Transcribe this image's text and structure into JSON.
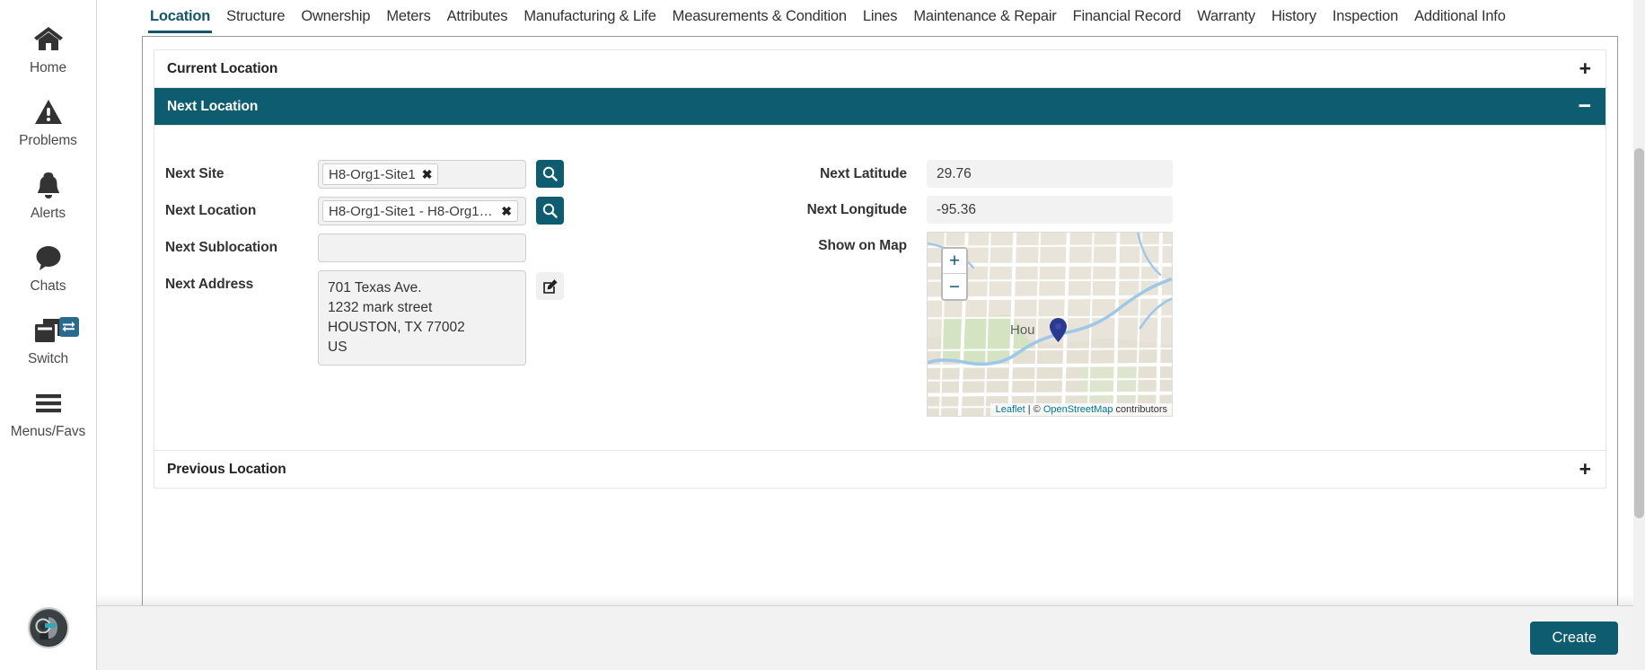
{
  "sidebar": {
    "items": [
      {
        "label": "Home",
        "icon": "home-icon"
      },
      {
        "label": "Problems",
        "icon": "warning-triangle-icon"
      },
      {
        "label": "Alerts",
        "icon": "bell-icon"
      },
      {
        "label": "Chats",
        "icon": "chat-bubble-icon"
      },
      {
        "label": "Switch",
        "icon": "switch-windows-icon",
        "badge_icon": "swap-arrows-icon"
      },
      {
        "label": "Menus/Favs",
        "icon": "hamburger-menu-icon"
      }
    ],
    "avatar": "user-avatar"
  },
  "tabs": [
    {
      "label": "Location",
      "active": true
    },
    {
      "label": "Structure",
      "active": false
    },
    {
      "label": "Ownership",
      "active": false
    },
    {
      "label": "Meters",
      "active": false
    },
    {
      "label": "Attributes",
      "active": false
    },
    {
      "label": "Manufacturing & Life",
      "active": false
    },
    {
      "label": "Measurements & Condition",
      "active": false
    },
    {
      "label": "Lines",
      "active": false
    },
    {
      "label": "Maintenance & Repair",
      "active": false
    },
    {
      "label": "Financial Record",
      "active": false
    },
    {
      "label": "Warranty",
      "active": false
    },
    {
      "label": "History",
      "active": false
    },
    {
      "label": "Inspection",
      "active": false
    },
    {
      "label": "Additional Info",
      "active": false
    }
  ],
  "sections": {
    "current_location": {
      "title": "Current Location",
      "toggle": "+",
      "expanded": false
    },
    "next_location": {
      "title": "Next Location",
      "toggle": "−",
      "expanded": true
    },
    "previous_location": {
      "title": "Previous Location",
      "toggle": "+",
      "expanded": false
    }
  },
  "form": {
    "next_site": {
      "label": "Next Site",
      "chip": "H8-Org1-Site1",
      "chip_remove": "✖",
      "search_icon": "magnifier-icon"
    },
    "next_location": {
      "label": "Next Location",
      "chip": "H8-Org1-Site1 - H8-Org1-S...",
      "chip_remove": "✖",
      "search_icon": "magnifier-icon"
    },
    "next_sublocation": {
      "label": "Next Sublocation",
      "value": "",
      "placeholder": ""
    },
    "next_address": {
      "label": "Next Address",
      "lines": [
        "701 Texas Ave.",
        "1232 mark street",
        "HOUSTON, TX  77002",
        "US"
      ],
      "edit_icon": "edit-pencil-icon"
    },
    "next_latitude": {
      "label": "Next Latitude",
      "value": "29.76"
    },
    "next_longitude": {
      "label": "Next Longitude",
      "value": "-95.36"
    },
    "show_on_map": {
      "label": "Show on Map"
    }
  },
  "map": {
    "zoom_in": "+",
    "zoom_out": "−",
    "city_label": "Hou",
    "marker": "location-pin-marker",
    "attribution": {
      "leaflet": "Leaflet",
      "separator": " | © ",
      "osm": "OpenStreetMap",
      "suffix": " contributors"
    }
  },
  "footer": {
    "create_label": "Create"
  },
  "colors": {
    "accent_teal": "#0d5c70",
    "tab_active": "#14566b",
    "badge_blue": "#2b6a8f",
    "link_blue": "#0078a8",
    "field_bg": "#f2f2f2"
  }
}
